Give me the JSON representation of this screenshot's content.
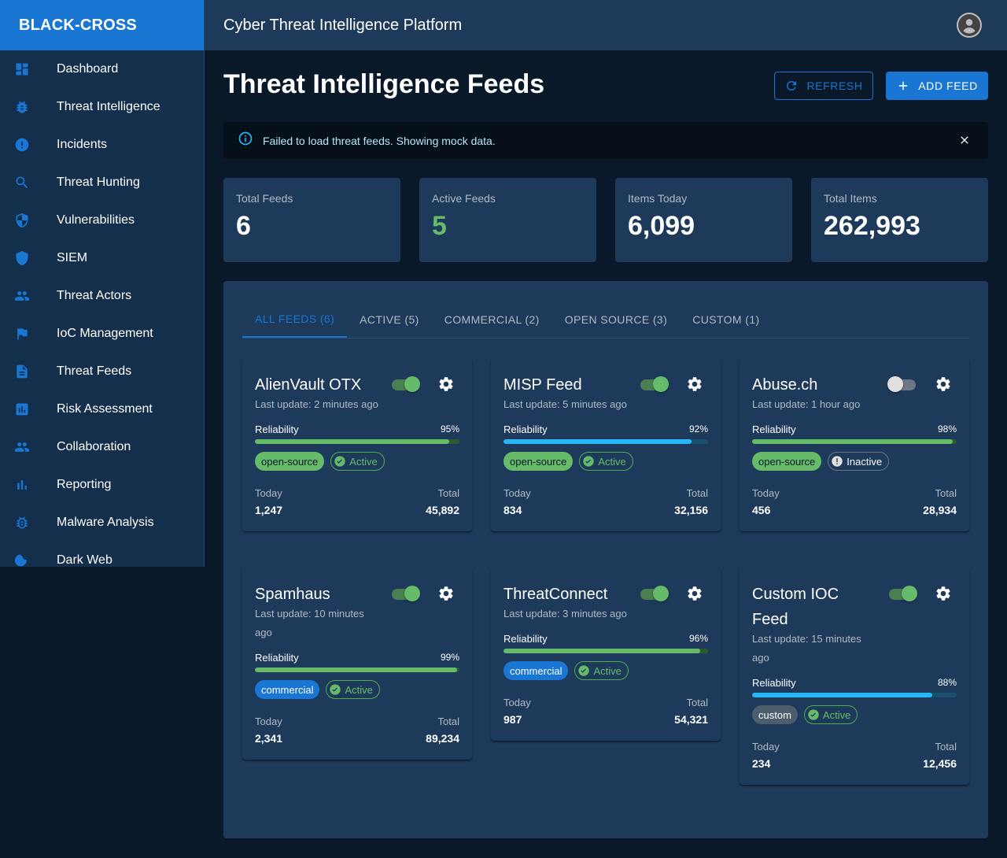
{
  "brand": "BLACK-CROSS",
  "topbar": {
    "title": "Cyber Threat Intelligence Platform"
  },
  "sidebar": {
    "items": [
      {
        "label": "Dashboard",
        "icon": "dashboard-icon"
      },
      {
        "label": "Threat Intelligence",
        "icon": "bug-icon"
      },
      {
        "label": "Incidents",
        "icon": "alert-icon"
      },
      {
        "label": "Threat Hunting",
        "icon": "search-icon"
      },
      {
        "label": "Vulnerabilities",
        "icon": "shield-half-icon"
      },
      {
        "label": "SIEM",
        "icon": "shield-icon"
      },
      {
        "label": "Threat Actors",
        "icon": "people-icon"
      },
      {
        "label": "IoC Management",
        "icon": "flag-icon"
      },
      {
        "label": "Threat Feeds",
        "icon": "document-icon"
      },
      {
        "label": "Risk Assessment",
        "icon": "assessment-icon"
      },
      {
        "label": "Collaboration",
        "icon": "group-icon"
      },
      {
        "label": "Reporting",
        "icon": "bar-chart-icon"
      },
      {
        "label": "Malware Analysis",
        "icon": "bug-outline-icon"
      },
      {
        "label": "Dark Web",
        "icon": "moon-icon"
      }
    ]
  },
  "page": {
    "title": "Threat Intelligence Feeds",
    "refresh_label": "REFRESH",
    "add_label": "ADD FEED"
  },
  "alert": {
    "message": "Failed to load threat feeds. Showing mock data."
  },
  "stats": [
    {
      "label": "Total Feeds",
      "value": "6",
      "color": "#ffffff"
    },
    {
      "label": "Active Feeds",
      "value": "5",
      "color": "#66bb6a"
    },
    {
      "label": "Items Today",
      "value": "6,099",
      "color": "#ffffff"
    },
    {
      "label": "Total Items",
      "value": "262,993",
      "color": "#ffffff"
    }
  ],
  "tabs": [
    {
      "label": "ALL FEEDS (6)",
      "active": true
    },
    {
      "label": "ACTIVE (5)",
      "active": false
    },
    {
      "label": "COMMERCIAL (2)",
      "active": false
    },
    {
      "label": "OPEN SOURCE (3)",
      "active": false
    },
    {
      "label": "CUSTOM (1)",
      "active": false
    }
  ],
  "labels": {
    "reliability": "Reliability",
    "today": "Today",
    "total": "Total"
  },
  "feeds": [
    {
      "name": "AlienVault OTX",
      "enabled": true,
      "last_update": "Last update: 2 minutes ago",
      "reliability": 95,
      "reliability_label": "95%",
      "bar_color": "#66bb6a",
      "type": "open-source",
      "status": "Active",
      "today": "1,247",
      "total": "45,892"
    },
    {
      "name": "MISP Feed",
      "enabled": true,
      "last_update": "Last update: 5 minutes ago",
      "reliability": 92,
      "reliability_label": "92%",
      "bar_color": "#29b6f6",
      "type": "open-source",
      "status": "Active",
      "today": "834",
      "total": "32,156"
    },
    {
      "name": "Abuse.ch",
      "enabled": false,
      "last_update": "Last update: 1 hour ago",
      "reliability": 98,
      "reliability_label": "98%",
      "bar_color": "#66bb6a",
      "type": "open-source",
      "status": "Inactive",
      "today": "456",
      "total": "28,934"
    },
    {
      "name": "Spamhaus",
      "enabled": true,
      "last_update": "Last update: 10 minutes ago",
      "reliability": 99,
      "reliability_label": "99%",
      "bar_color": "#66bb6a",
      "type": "commercial",
      "status": "Active",
      "today": "2,341",
      "total": "89,234"
    },
    {
      "name": "ThreatConnect",
      "enabled": true,
      "last_update": "Last update: 3 minutes ago",
      "reliability": 96,
      "reliability_label": "96%",
      "bar_color": "#66bb6a",
      "type": "commercial",
      "status": "Active",
      "today": "987",
      "total": "54,321"
    },
    {
      "name": "Custom IOC Feed",
      "enabled": true,
      "last_update": "Last update: 15 minutes ago",
      "reliability": 88,
      "reliability_label": "88%",
      "bar_color": "#29b6f6",
      "type": "custom",
      "status": "Active",
      "today": "234",
      "total": "12,456"
    }
  ]
}
